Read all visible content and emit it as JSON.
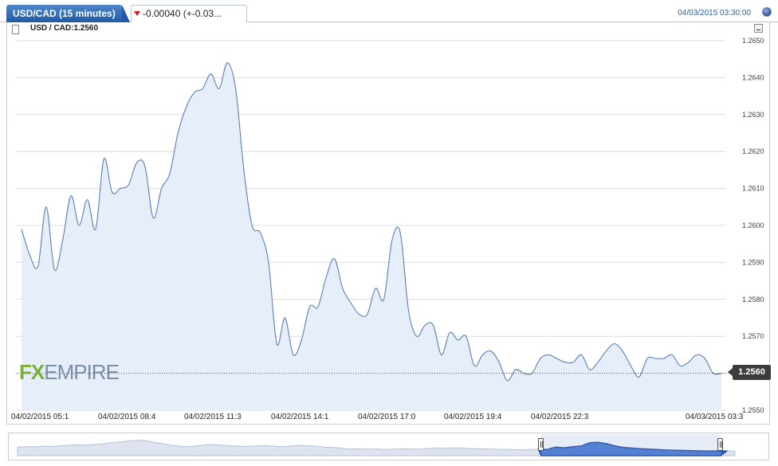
{
  "header": {
    "symbol_tab": "USD/CAD (15 minutes)",
    "change_text": "-0.00040 (+-0.03...",
    "datetime": "04/03/2015 03:30:00"
  },
  "legend": {
    "label": "USD / CAD:1.2560"
  },
  "watermark": {
    "fx": "FX",
    "rest": "EMPIRE"
  },
  "price_label": "1.2560",
  "colors": {
    "line": "#5b7fb5",
    "area": "#e6eefa",
    "accent": "#1e5aa5",
    "down": "#d11a1a"
  },
  "chart_data": {
    "type": "area",
    "title": "",
    "xlabel": "",
    "ylabel": "",
    "ylim": [
      1.255,
      1.265
    ],
    "yticks": [
      "1.2550",
      "1.2560",
      "1.2570",
      "1.2580",
      "1.2590",
      "1.2600",
      "1.2610",
      "1.2620",
      "1.2630",
      "1.2640",
      "1.2650"
    ],
    "xticks": [
      "04/02/2015 05:1",
      "04/02/2015 08:4",
      "04/02/2015 11:3",
      "04/02/2015 14:1",
      "04/02/2015 17:0",
      "04/02/2015 19:4",
      "04/02/2015 22:3",
      "04/03/2015 03:3"
    ],
    "grid": true,
    "current_value": 1.256,
    "series": [
      {
        "values": [
          1.2599,
          1.2592,
          1.2589,
          1.2605,
          1.2588,
          1.2596,
          1.2608,
          1.26,
          1.2607,
          1.2599,
          1.2618,
          1.2609,
          1.261,
          1.2611,
          1.2617,
          1.2616,
          1.2602,
          1.261,
          1.2614,
          1.2625,
          1.2632,
          1.2636,
          1.2637,
          1.2641,
          1.2637,
          1.2644,
          1.2637,
          1.2615,
          1.26,
          1.2598,
          1.259,
          1.2568,
          1.2575,
          1.2565,
          1.2569,
          1.2578,
          1.2578,
          1.2586,
          1.2591,
          1.2583,
          1.2579,
          1.2576,
          1.2576,
          1.2583,
          1.258,
          1.2596,
          1.2598,
          1.2577,
          1.257,
          1.2573,
          1.2573,
          1.2565,
          1.2571,
          1.2569,
          1.257,
          1.2562,
          1.2565,
          1.2566,
          1.2563,
          1.2558,
          1.2561,
          1.256,
          1.256,
          1.2564,
          1.2565,
          1.2564,
          1.2563,
          1.2563,
          1.2565,
          1.2561,
          1.2563,
          1.2566,
          1.2568,
          1.2566,
          1.2562,
          1.2559,
          1.2564,
          1.2564,
          1.2564,
          1.2565,
          1.2562,
          1.2563,
          1.2565,
          1.2564,
          1.256,
          1.256
        ]
      }
    ]
  },
  "navigator": {
    "values": [
      0.4,
      0.42,
      0.41,
      0.44,
      0.43,
      0.46,
      0.48,
      0.5,
      0.49,
      0.52,
      0.55,
      0.6,
      0.64,
      0.68,
      0.72,
      0.7,
      0.62,
      0.55,
      0.48,
      0.44,
      0.42,
      0.45,
      0.5,
      0.52,
      0.48,
      0.46,
      0.44,
      0.43,
      0.45,
      0.47,
      0.44,
      0.42,
      0.45,
      0.48,
      0.46,
      0.44,
      0.4,
      0.38,
      0.34,
      0.3,
      0.32,
      0.3,
      0.31,
      0.29,
      0.3,
      0.32,
      0.31,
      0.3,
      0.33,
      0.35,
      0.34,
      0.36,
      0.35,
      0.33,
      0.32,
      0.31,
      0.3,
      0.29,
      0.28,
      0.27,
      0.28,
      0.3,
      0.29,
      0.4,
      0.36,
      0.42,
      0.45,
      0.6,
      0.62,
      0.55,
      0.45,
      0.38,
      0.35,
      0.32,
      0.3,
      0.28,
      0.26,
      0.25,
      0.24,
      0.23,
      0.22,
      0.21,
      0.22,
      0.21,
      0.22
    ],
    "selection": [
      0.73,
      0.98
    ]
  }
}
